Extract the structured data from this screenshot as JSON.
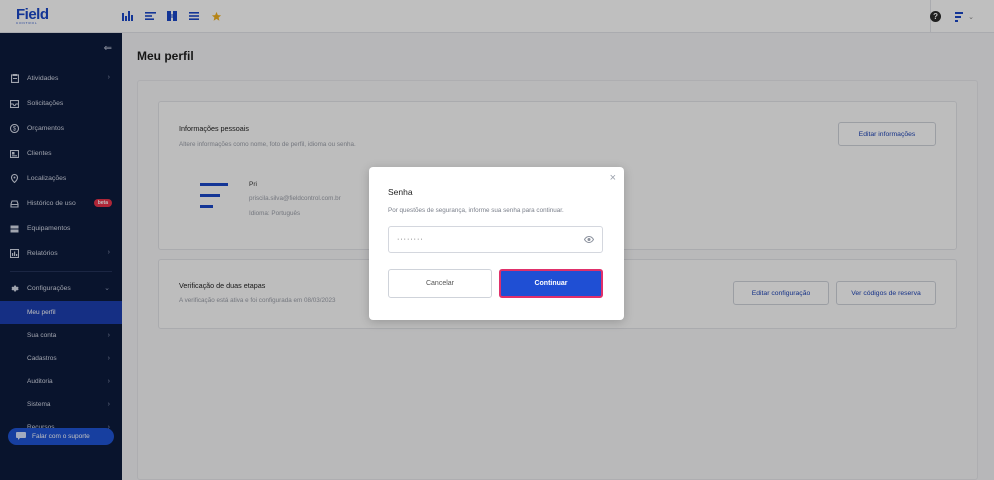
{
  "topbar": {
    "logo": "Field",
    "logo_sub": "CONTROL",
    "icons": [
      "bar-chart-icon",
      "list-icon",
      "columns-icon",
      "menu-icon",
      "star-icon"
    ],
    "help": "?",
    "brand_chevron": "⌄"
  },
  "sidebar": {
    "collapse_icon": "⇐",
    "items": [
      {
        "label": "Atividades",
        "icon": "clipboard-icon",
        "chevron": true
      },
      {
        "label": "Solicitações",
        "icon": "inbox-icon"
      },
      {
        "label": "Orçamentos",
        "icon": "dollar-icon"
      },
      {
        "label": "Clientes",
        "icon": "id-card-icon"
      },
      {
        "label": "Localizações",
        "icon": "pin-icon"
      },
      {
        "label": "Histórico de uso",
        "icon": "car-icon",
        "badge": "beta"
      },
      {
        "label": "Equipamentos",
        "icon": "device-icon"
      },
      {
        "label": "Relatórios",
        "icon": "report-icon",
        "chevron": true
      }
    ],
    "config": {
      "label": "Configurações",
      "icon": "gear-icon"
    },
    "sub_items": [
      {
        "label": "Meu perfil",
        "active": true
      },
      {
        "label": "Sua conta",
        "chevron": true
      },
      {
        "label": "Cadastros",
        "chevron": true
      },
      {
        "label": "Auditoria",
        "chevron": true
      },
      {
        "label": "Sistema",
        "chevron": true
      },
      {
        "label": "Recursos",
        "chevron": true
      }
    ],
    "support": "Falar com o suporte"
  },
  "main": {
    "title": "Meu perfil",
    "personal": {
      "title": "Informações pessoais",
      "desc": "Altere informações como nome, foto de perfil, idioma ou senha.",
      "button": "Editar informações",
      "name": "Pri",
      "email": "priscila.silva@fieldcontrol.com.br",
      "language": "Idioma: Português"
    },
    "twofa": {
      "title": "Verificação de duas etapas",
      "desc": "A verificação está ativa e foi configurada em 08/03/2023",
      "button_config": "Editar configuração",
      "button_codes": "Ver códigos de reserva"
    }
  },
  "modal": {
    "close": "×",
    "title": "Senha",
    "desc": "Por questões de segurança, informe sua senha para continuar.",
    "password_mask": "········",
    "cancel": "Cancelar",
    "continue": "Continuar"
  },
  "colors": {
    "sidebar_bg": "#0d1b3d",
    "accent": "#1f4fd4",
    "active_item": "#1d3fb0",
    "beta": "#e8334a",
    "focus_ring": "#e0306a"
  }
}
